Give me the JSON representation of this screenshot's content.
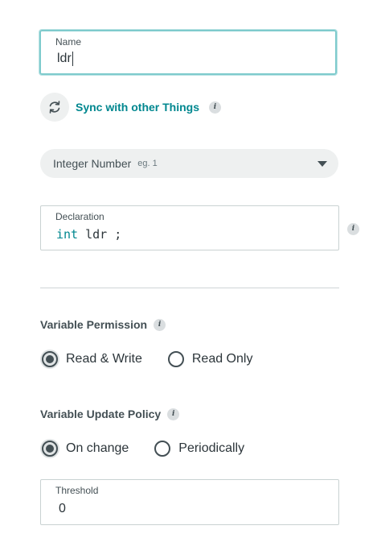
{
  "name_field": {
    "label": "Name",
    "value": "ldr"
  },
  "sync": {
    "label": "Sync with other Things",
    "icon": "sync-icon",
    "info_icon_text": "i"
  },
  "type_select": {
    "value": "Integer Number",
    "hint": "eg. 1"
  },
  "declaration": {
    "label": "Declaration",
    "keyword": "int",
    "identifier": " ldr ;",
    "info_icon_text": "i"
  },
  "permission": {
    "title": "Variable Permission",
    "info_icon_text": "i",
    "options": [
      {
        "label": "Read & Write",
        "checked": true
      },
      {
        "label": "Read Only",
        "checked": false
      }
    ]
  },
  "update_policy": {
    "title": "Variable Update Policy",
    "info_icon_text": "i",
    "options": [
      {
        "label": "On change",
        "checked": true
      },
      {
        "label": "Periodically",
        "checked": false
      }
    ]
  },
  "threshold": {
    "label": "Threshold",
    "value": "0"
  },
  "colors": {
    "accent": "#00878f",
    "focus_border": "#7fcbcd",
    "text": "#434f54",
    "pill_bg": "#eef0f0"
  }
}
